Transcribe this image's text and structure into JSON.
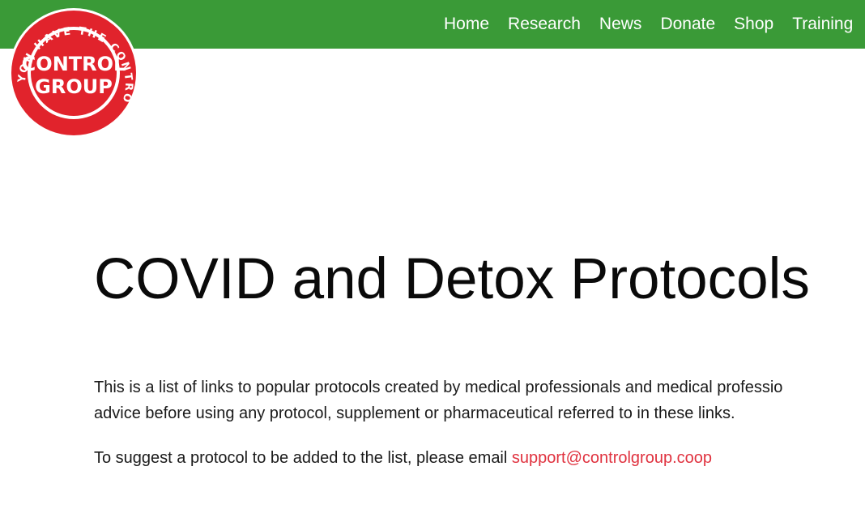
{
  "nav": {
    "items": [
      {
        "label": "Home"
      },
      {
        "label": "Research"
      },
      {
        "label": "News"
      },
      {
        "label": "Donate"
      },
      {
        "label": "Shop"
      },
      {
        "label": "Training"
      }
    ]
  },
  "logo": {
    "line1": "CONTROL",
    "line2": "GROUP",
    "ring_text": "YOU HAVE THE CONTROL"
  },
  "main": {
    "title": "COVID and Detox Protocols",
    "intro_line1": "This is a list of links to popular protocols created by medical professionals and medical professio",
    "intro_line2": "advice before using any protocol, supplement or pharmaceutical referred to in these links.",
    "suggest_text": "To suggest a protocol to be added to the list, please email ",
    "email": "support@controlgroup.coop"
  },
  "colors": {
    "header_green": "#3a9a37",
    "logo_red": "#e1232c",
    "link_red": "#e0323f"
  }
}
